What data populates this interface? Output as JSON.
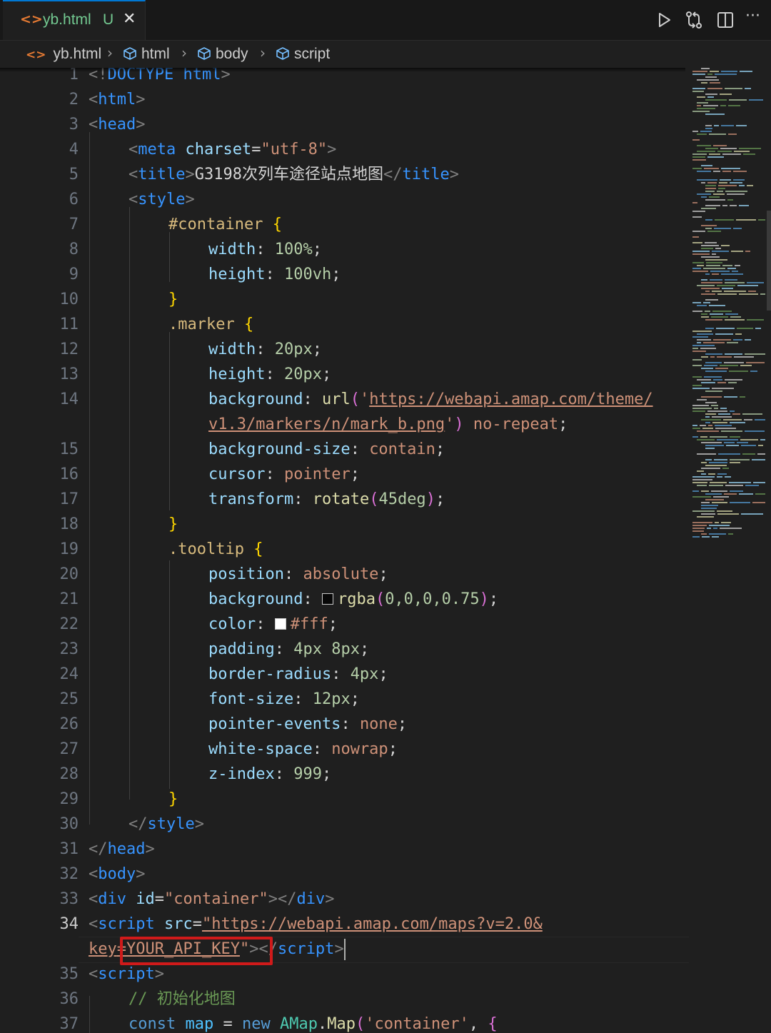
{
  "tab": {
    "icon": "html-file-icon",
    "filename": "yb.html",
    "status": "U"
  },
  "editor_actions": [
    "run-icon",
    "compare-changes-icon",
    "split-editor-icon",
    "more-actions-icon"
  ],
  "actions_more": "···",
  "breadcrumb": [
    {
      "label": "yb.html",
      "icon": "html-file-icon"
    },
    {
      "label": "html",
      "icon": "element-icon"
    },
    {
      "label": "body",
      "icon": "element-icon"
    },
    {
      "label": "script",
      "icon": "element-icon"
    }
  ],
  "breadcrumb_separator": "›",
  "colors": {
    "tag": "#3794ff",
    "attribute": "#9cdcfe",
    "string": "#ce9178",
    "selector": "#d7ba7d",
    "number": "#b5cea8",
    "comment": "#6a9955",
    "highlight_box": "#d01a1a",
    "modified": "#73c991"
  },
  "line_numbers": [
    "1",
    "2",
    "3",
    "4",
    "5",
    "6",
    "7",
    "8",
    "9",
    "10",
    "11",
    "12",
    "13",
    "14",
    "15",
    "16",
    "17",
    "18",
    "19",
    "20",
    "21",
    "22",
    "23",
    "24",
    "25",
    "26",
    "27",
    "28",
    "29",
    "30",
    "31",
    "32",
    "33",
    "34",
    "35",
    "36",
    "37"
  ],
  "active_line": "34",
  "code": {
    "l1": [
      "<!",
      "DOCTYPE html",
      ">"
    ],
    "l2": [
      "<",
      "html",
      ">"
    ],
    "l3": [
      "<",
      "head",
      ">"
    ],
    "l4": [
      "<",
      "meta",
      " ",
      "charset",
      "=",
      "\"utf-8\"",
      ">"
    ],
    "l5": [
      "<",
      "title",
      ">",
      "G3198次列车途径站点地图",
      "</",
      "title",
      ">"
    ],
    "l6": [
      "<",
      "style",
      ">"
    ],
    "l7": [
      "#container",
      " ",
      "{"
    ],
    "l8": [
      "width",
      ": ",
      "100%",
      ";"
    ],
    "l9": [
      "height",
      ": ",
      "100vh",
      ";"
    ],
    "l10": [
      "}"
    ],
    "l11": [
      ".marker",
      " ",
      "{"
    ],
    "l12": [
      "width",
      ": ",
      "20px",
      ";"
    ],
    "l13": [
      "height",
      ": ",
      "20px",
      ";"
    ],
    "l14a": [
      "background",
      ": ",
      "url",
      "(",
      "'",
      "https://webapi.amap.com/theme/"
    ],
    "l14b": [
      "v1.3/markers/n/mark_b.png",
      "'",
      ")",
      " ",
      "no-repeat",
      ";"
    ],
    "l15": [
      "background-size",
      ": ",
      "contain",
      ";"
    ],
    "l16": [
      "cursor",
      ": ",
      "pointer",
      ";"
    ],
    "l17": [
      "transform",
      ": ",
      "rotate",
      "(",
      "45deg",
      ")",
      ";"
    ],
    "l18": [
      "}"
    ],
    "l19": [
      ".tooltip",
      " ",
      "{"
    ],
    "l20": [
      "position",
      ": ",
      "absolute",
      ";"
    ],
    "l21": [
      "background",
      ": ",
      "rgba",
      "(",
      "0,0,0,0.75",
      ")",
      ";"
    ],
    "l22": [
      "color",
      ": ",
      "#fff",
      ";"
    ],
    "l23": [
      "padding",
      ": ",
      "4px 8px",
      ";"
    ],
    "l24": [
      "border-radius",
      ": ",
      "4px",
      ";"
    ],
    "l25": [
      "font-size",
      ": ",
      "12px",
      ";"
    ],
    "l26": [
      "pointer-events",
      ": ",
      "none",
      ";"
    ],
    "l27": [
      "white-space",
      ": ",
      "nowrap",
      ";"
    ],
    "l28": [
      "z-index",
      ": ",
      "999",
      ";"
    ],
    "l29": [
      "}"
    ],
    "l30": [
      "</",
      "style",
      ">"
    ],
    "l31": [
      "</",
      "head",
      ">"
    ],
    "l32": [
      "<",
      "body",
      ">"
    ],
    "l33": [
      "<",
      "div",
      " ",
      "id",
      "=",
      "\"container\"",
      "></",
      "div",
      ">"
    ],
    "l34a": [
      "<",
      "script",
      " ",
      "src",
      "=",
      "\"https://webapi.amap.com/maps?v=2.0&"
    ],
    "l34b": [
      "key",
      "=",
      "YOUR_API_KEY",
      "\"",
      "></",
      "script",
      ">"
    ],
    "l35": [
      "<",
      "script",
      ">"
    ],
    "l36": [
      "// 初始化地图"
    ],
    "l37": [
      "const",
      " ",
      "map",
      " = ",
      "new",
      " ",
      "AMap",
      ".",
      "Map",
      "(",
      "'container'",
      ", ",
      "{"
    ]
  },
  "swatch_colors": {
    "rgba": "rgba(0,0,0,0.75)",
    "white": "#ffffff"
  }
}
